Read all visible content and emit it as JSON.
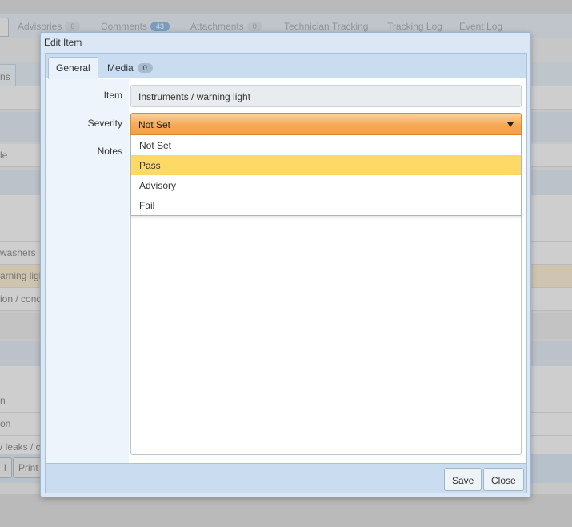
{
  "background": {
    "tabs": [
      {
        "label": "Advisories",
        "count": "0"
      },
      {
        "label": "Comments",
        "count": "43"
      },
      {
        "label": "Attachments",
        "count": "0"
      },
      {
        "label": "Technician Tracking"
      },
      {
        "label": "Tracking Log"
      },
      {
        "label": "Event Log"
      }
    ],
    "left_tab_fragment": "ns",
    "rows": [
      "le",
      "washers",
      "arning ligh",
      "ion / cond",
      "n",
      "on",
      "/ leaks / c"
    ],
    "buttons": [
      "l",
      "Print"
    ]
  },
  "dialog": {
    "title": "Edit Item",
    "tabs": [
      {
        "label": "General"
      },
      {
        "label": "Media",
        "count": "0"
      }
    ],
    "fields": {
      "item_label": "Item",
      "item_value": "Instruments / warning light",
      "severity_label": "Severity",
      "severity_value": "Not Set",
      "notes_label": "Notes"
    },
    "severity_options": [
      "Not Set",
      "Pass",
      "Advisory",
      "Fail"
    ],
    "hovered_option": "Pass",
    "buttons": {
      "save": "Save",
      "close": "Close"
    }
  },
  "colors": {
    "select_accent": "#f6a956",
    "option_hover": "#ffd966",
    "dialog_chrome": "#c9dcf0"
  }
}
